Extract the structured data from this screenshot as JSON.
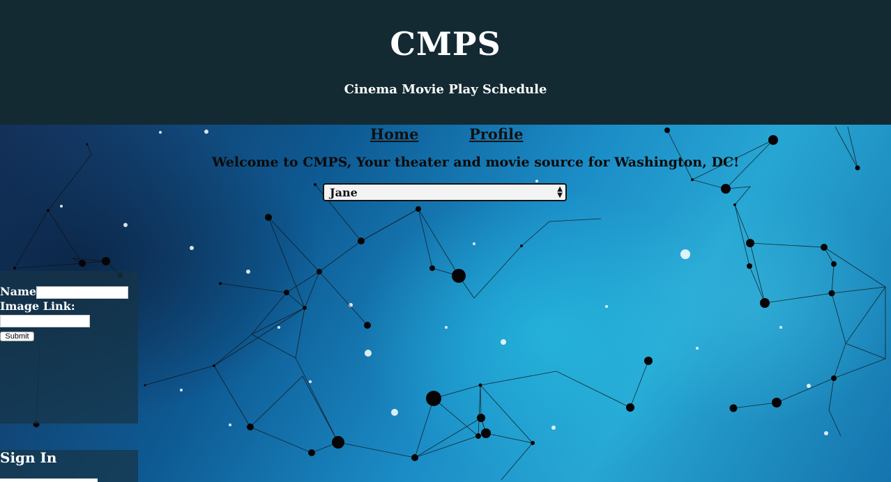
{
  "header": {
    "brand": "CMPS",
    "tagline": "Cinema Movie Play Schedule"
  },
  "nav": {
    "home": "Home",
    "profile": "Profile"
  },
  "welcome": "Welcome to CMPS, Your theater and movie source for Washington, DC!",
  "user_select": {
    "selected": "Jane"
  },
  "upload_form": {
    "name_label": "Name:",
    "image_label": "Image Link:",
    "name_value": "",
    "image_value": "",
    "submit_label": "Submit"
  },
  "signin": {
    "title": "Sign In"
  },
  "colors": {
    "header_bg": "#132a33",
    "header_text": "#ffffff",
    "nav_text": "#111111"
  }
}
